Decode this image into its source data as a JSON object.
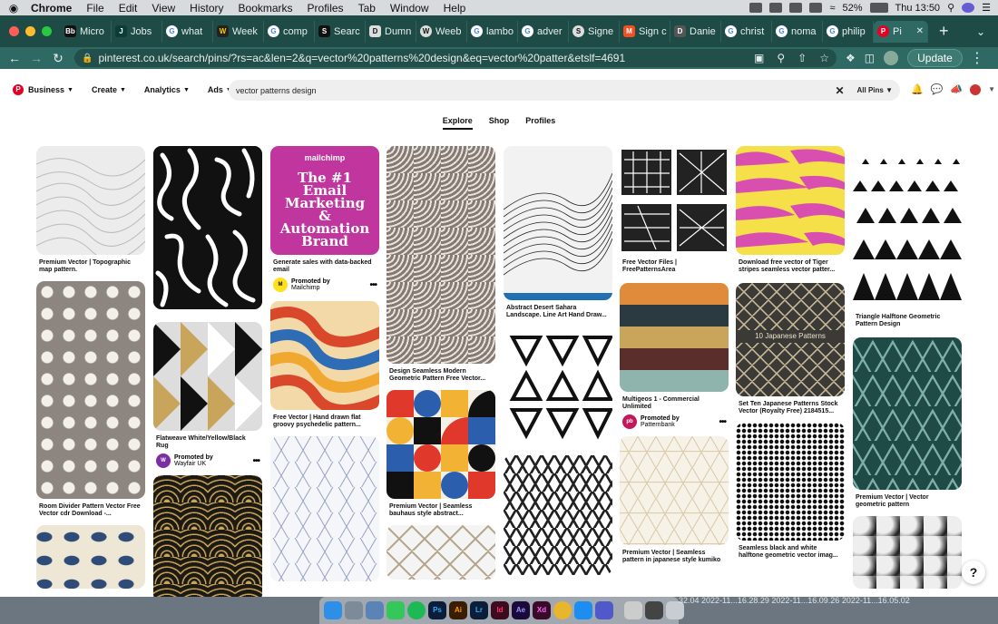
{
  "menubar": {
    "app": "Chrome",
    "items": [
      "File",
      "Edit",
      "View",
      "History",
      "Bookmarks",
      "Profiles",
      "Tab",
      "Window",
      "Help"
    ],
    "battery": "52%",
    "clock": "Thu 13:50"
  },
  "tabs": [
    {
      "label": "Micro",
      "icon": "Bb"
    },
    {
      "label": "Jobs",
      "icon": "J"
    },
    {
      "label": "what",
      "icon": "G"
    },
    {
      "label": "Week",
      "icon": "W"
    },
    {
      "label": "comp",
      "icon": "G"
    },
    {
      "label": "Searc",
      "icon": "S"
    },
    {
      "label": "Dumn",
      "icon": "D"
    },
    {
      "label": "Weeb",
      "icon": "W"
    },
    {
      "label": "lambo",
      "icon": "G"
    },
    {
      "label": "adver",
      "icon": "G"
    },
    {
      "label": "Signe",
      "icon": "S"
    },
    {
      "label": "Sign c",
      "icon": "M"
    },
    {
      "label": "Danie",
      "icon": "D"
    },
    {
      "label": "christ",
      "icon": "G"
    },
    {
      "label": "noma",
      "icon": "G"
    },
    {
      "label": "philip",
      "icon": "G"
    },
    {
      "label": "Pi",
      "icon": "P",
      "active": true
    }
  ],
  "toolbar": {
    "url": "pinterest.co.uk/search/pins/?rs=ac&len=2&q=vector%20patterns%20design&eq=vector%20patter&etslf=4691",
    "update_label": "Update"
  },
  "pinterest": {
    "nav": [
      "Business",
      "Create",
      "Analytics",
      "Ads"
    ],
    "search_value": "vector patterns design",
    "filter_label": "All Pins",
    "subtabs": [
      "Explore",
      "Shop",
      "Profiles"
    ],
    "ad": {
      "brand": "mailchimp",
      "headline": "The #1 Email Marketing & Automation Brand"
    },
    "pins": {
      "c1p1": "Premium Vector | Topographic map pattern.",
      "c1p2": "Room Divider Pattern Vector Free Vector cdr Download -...",
      "c2p2": "Flatweave White/Yellow/Black Rug",
      "c2p2_promoted": "Promoted by",
      "c2p2_by": "Wayfair UK",
      "c3p1": "Generate sales with data-backed email",
      "c3p1_promoted": "Promoted by",
      "c3p1_by": "Mailchimp",
      "c3p2": "Free Vector | Hand drawn flat groovy psychedelic pattern...",
      "c4p1": "Design Seamless Modern Geometric Pattern Free Vector...",
      "c4p2": "Premium Vector | Seamless bauhaus style abstract...",
      "c5p1": "Abstract Desert Sahara Landscape. Line Art Hand Draw...",
      "c6p1": "Free Vector Files | FreePatternsArea",
      "c6p2": "Multigeos 1 - Commercial Unlimited",
      "c6p2_promoted": "Promoted by",
      "c6p2_by": "Patternbank",
      "c6p3": "Premium Vector | Seamless pattern in japanese style kumiko",
      "c7p1": "Download free vector of Tiger stripes seamless vector patter...",
      "c7p2": "Set Ten Japanese Patterns Stock Vector (Royalty Free) 2184515...",
      "c7p2_banner": "10 Japanese Patterns",
      "c7p3": "Seamless black and white halftone geometric vector imag...",
      "c8p1": "Triangle Halftone Geometric Pattern Design",
      "c8p2": "Premium Vector | Vector geometric pattern"
    },
    "help_label": "?"
  },
  "dock": {
    "apps": [
      {
        "name": "finder",
        "label": "",
        "color": "#2d8fe6"
      },
      {
        "name": "launchpad",
        "label": "",
        "color": "#7d8a99"
      },
      {
        "name": "preview",
        "label": "",
        "color": "#5a84b5"
      },
      {
        "name": "messages",
        "label": "",
        "color": "#34c759"
      },
      {
        "name": "spotify",
        "label": "",
        "color": "#1db954"
      },
      {
        "name": "photoshop",
        "label": "Ps",
        "color": "#0a1e3a"
      },
      {
        "name": "illustrator",
        "label": "Ai",
        "color": "#3a1d00"
      },
      {
        "name": "lightroom",
        "label": "Lr",
        "color": "#0a1e3a"
      },
      {
        "name": "indesign",
        "label": "Id",
        "color": "#3d0a1f"
      },
      {
        "name": "after-effects",
        "label": "Ae",
        "color": "#1a0a3a"
      },
      {
        "name": "xd",
        "label": "Xd",
        "color": "#3a0a2a"
      },
      {
        "name": "chrome",
        "label": "",
        "color": "#e8b62c"
      },
      {
        "name": "app-store",
        "label": "",
        "color": "#1c8ef2"
      },
      {
        "name": "teams",
        "label": "",
        "color": "#5059c9"
      }
    ],
    "desktop_files": "32.04  2022-11...16.28.29  2022-11...16.09.26  2022-11...16.05.02"
  }
}
